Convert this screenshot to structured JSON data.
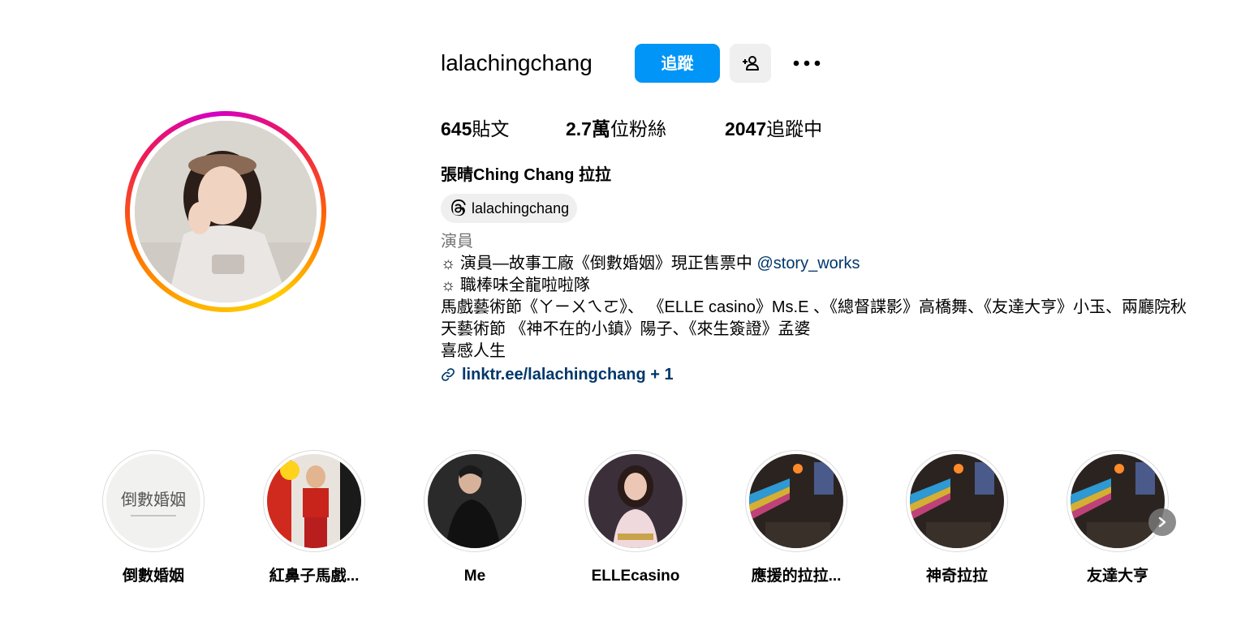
{
  "profile": {
    "username": "lalachingchang",
    "follow_label": "追蹤",
    "stats": {
      "posts_count": "645",
      "posts_label": "貼文",
      "followers_count": "2.7萬",
      "followers_label": "位粉絲",
      "following_count": "2047",
      "following_label": "追蹤中"
    },
    "full_name": "張晴Ching Chang 拉拉",
    "threads_handle": "lalachingchang",
    "bio": {
      "category": "演員",
      "line1_text": "☼ 演員—故事工廠《倒數婚姻》現正售票中 ",
      "line1_mention": "@story_works",
      "line2": "☼ 職棒味全龍啦啦隊",
      "line3": "馬戲藝術節《ㄚㄧㄨㄟㄛ》、 《ELLE casino》Ms.E 、《總督諜影》高橋舞、《友達大亨》小玉、兩廳院秋天藝術節 《神不在的小鎮》陽子、《來生簽證》孟婆",
      "line4": "喜感人生"
    },
    "link_text": "linktr.ee/lalachingchang + 1"
  },
  "highlights": [
    {
      "label": "倒數婚姻"
    },
    {
      "label": "紅鼻子馬戲..."
    },
    {
      "label": "Me"
    },
    {
      "label": "ELLEcasino"
    },
    {
      "label": "應援的拉拉..."
    },
    {
      "label": "神奇拉拉"
    },
    {
      "label": "友達大亨"
    }
  ],
  "highlight_1_text": "倒數婚姻",
  "colors": {
    "accent": "#0095f6",
    "link": "#00376b",
    "secondary_text": "#737373",
    "button_gray": "#efefef"
  },
  "icons": {
    "add_person": "person-plus-icon",
    "more": "more-horizontal-icon",
    "threads": "threads-icon",
    "link": "link-icon",
    "next": "chevron-right-icon"
  }
}
